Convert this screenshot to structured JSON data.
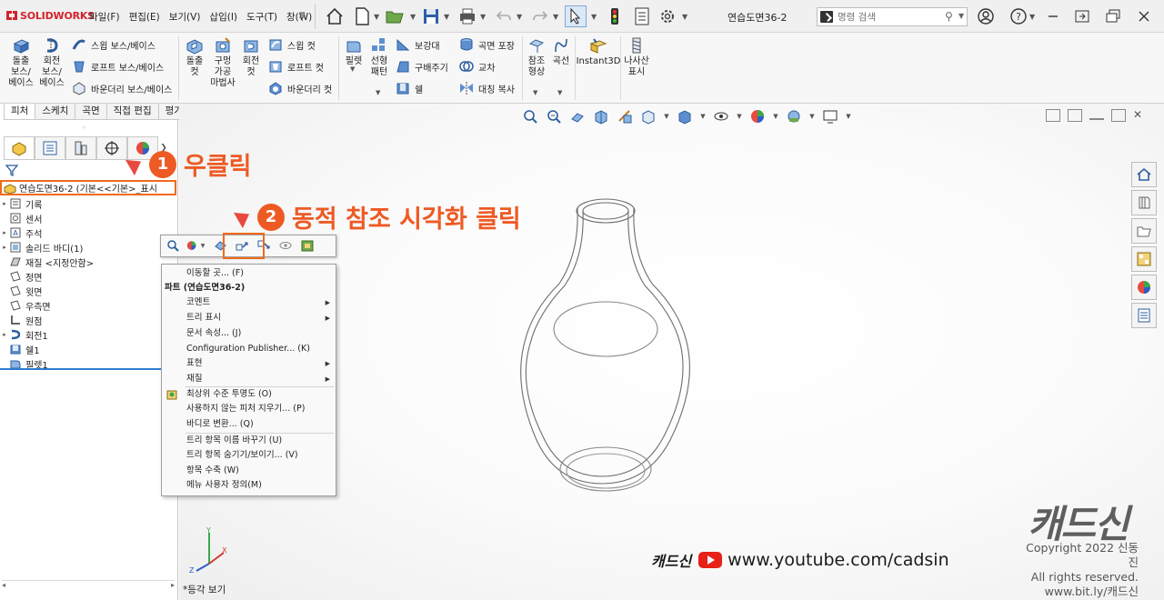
{
  "app": {
    "brand": "SOLIDWORKS",
    "doc_title": "연습도면36-2"
  },
  "menu": [
    "파일(F)",
    "편집(E)",
    "보기(V)",
    "삽입(I)",
    "도구(T)",
    "창(W)"
  ],
  "search": {
    "placeholder": "명령 검색"
  },
  "command_manager": {
    "features": {
      "extrude_boss": "돌출\n보스/\n베이스",
      "revolve_boss": "회전\n보스/\n베이스",
      "sweep_boss": "스윕 보스/베이스",
      "loft_boss": "로프트 보스/베이스",
      "boundary_boss": "바운더리 보스/베이스",
      "extrude_cut": "돌출\n컷",
      "hole_wizard": "구멍\n가공\n마법사",
      "revolve_cut": "회전\n컷",
      "sweep_cut": "스윕 컷",
      "loft_cut": "로프트 컷",
      "boundary_cut": "바운더리 컷",
      "fillet": "필렛",
      "linear_pattern": "선형\n패턴",
      "rib": "보강대",
      "draft": "구배주기",
      "shell": "쉘",
      "wrap": "곡면 포장",
      "intersect": "교차",
      "mirror": "대칭 복사",
      "ref_geometry": "참조\n형상",
      "curves": "곡선",
      "instant3d": "Instant3D",
      "helix": "나사산\n표시"
    }
  },
  "tabs": [
    "피처",
    "스케치",
    "곡면",
    "직접 편집",
    "평가"
  ],
  "feature_tree": {
    "root": "연습도면36-2  (기본<<기본>_표시",
    "items": [
      {
        "label": "기록",
        "expandable": true,
        "icon": "history-icon"
      },
      {
        "label": "센서",
        "expandable": false,
        "icon": "sensor-icon"
      },
      {
        "label": "주석",
        "expandable": true,
        "icon": "annotation-icon"
      },
      {
        "label": "솔리드 바디(1)",
        "expandable": true,
        "icon": "solid-body-icon"
      },
      {
        "label": "재질 <지정안함>",
        "expandable": false,
        "icon": "material-icon"
      },
      {
        "label": "정면",
        "expandable": false,
        "icon": "plane-icon"
      },
      {
        "label": "윗면",
        "expandable": false,
        "icon": "plane-icon"
      },
      {
        "label": "우측면",
        "expandable": false,
        "icon": "plane-icon"
      },
      {
        "label": "원점",
        "expandable": false,
        "icon": "origin-icon"
      },
      {
        "label": "회전1",
        "expandable": true,
        "icon": "revolve-feature-icon"
      },
      {
        "label": "쉘1",
        "expandable": false,
        "icon": "shell-feature-icon"
      },
      {
        "label": "필렛1",
        "expandable": false,
        "icon": "fillet-feature-icon"
      }
    ]
  },
  "annotations": {
    "step1": {
      "num": "1",
      "text": "우클릭"
    },
    "step2": {
      "num": "2",
      "text": "동적 참조 시각화 클릭"
    }
  },
  "context_menu": {
    "items": [
      {
        "label": "이동할 곳... (F)",
        "type": "item"
      },
      {
        "label": "파트 (연습도면36-2)",
        "type": "header"
      },
      {
        "label": "코멘트",
        "type": "submenu"
      },
      {
        "label": "트리 표시",
        "type": "submenu"
      },
      {
        "label": "문서 속성... (J)",
        "type": "item"
      },
      {
        "label": "Configuration Publisher... (K)",
        "type": "item"
      },
      {
        "label": "표현",
        "type": "submenu"
      },
      {
        "label": "재질",
        "type": "submenu"
      },
      {
        "label": "최상위 수준 투명도 (O)",
        "type": "item",
        "icon": "transparency-icon"
      },
      {
        "label": "사용하지 않는 피처 지우기... (P)",
        "type": "item"
      },
      {
        "label": "바디로 변환... (Q)",
        "type": "item"
      },
      {
        "label": "트리 항목 이름 바꾸기 (U)",
        "type": "item"
      },
      {
        "label": "트리 항목 숨기기/보이기... (V)",
        "type": "item"
      },
      {
        "label": "항목 수축 (W)",
        "type": "item"
      },
      {
        "label": "메뉴 사용자 정의(M)",
        "type": "item"
      }
    ]
  },
  "view": {
    "label": "*등각 보기"
  },
  "watermark": {
    "brand": "캐드신",
    "url": "www.youtube.com/cadsin",
    "logo": "캐드신",
    "copyright": "Copyright 2022 신동진",
    "rights": "All rights reserved.",
    "link": "www.bit.ly/캐드신"
  },
  "colors": {
    "accent": "#ee5a24",
    "highlight_border": "#f06a1c",
    "tree_line": "#2f7bd1"
  }
}
